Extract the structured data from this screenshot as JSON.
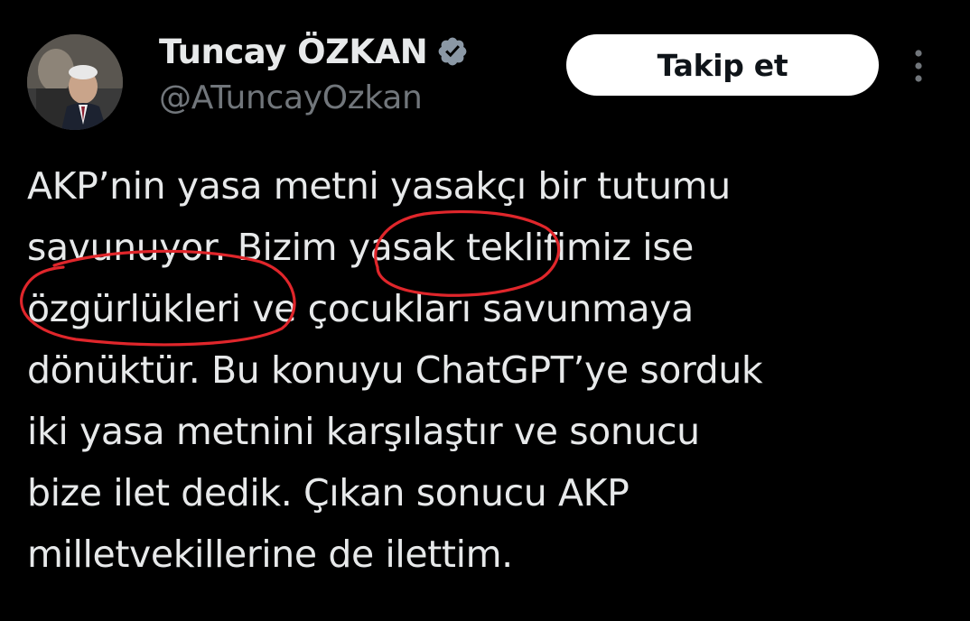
{
  "author": {
    "display_name": "Tuncay ÖZKAN",
    "handle": "@ATuncayOzkan",
    "verified_icon": "verified-badge-icon",
    "verified_color": "#8b98a5"
  },
  "actions": {
    "follow_label": "Takip et",
    "more_icon": "more-options-icon"
  },
  "tweet": {
    "lines": [
      "AKP’nin yasa metni yasakçı bir tutumu",
      "savunuyor. Bizim yasak teklifimiz ise",
      "özgürlükleri ve çocukları savunmaya",
      "dönüktür. Bu konuyu ChatGPT’ye sorduk",
      "iki yasa metnini karşılaştır ve sonucu",
      "bize ilet dedik. Çıkan sonucu AKP",
      "milletvekillerine de ilettim."
    ]
  },
  "colors": {
    "background": "#000000",
    "text": "#e7e9ea",
    "secondary_text": "#71767b",
    "annotation": "#e0262b",
    "button_bg": "#ffffff",
    "button_text": "#0f1419"
  }
}
